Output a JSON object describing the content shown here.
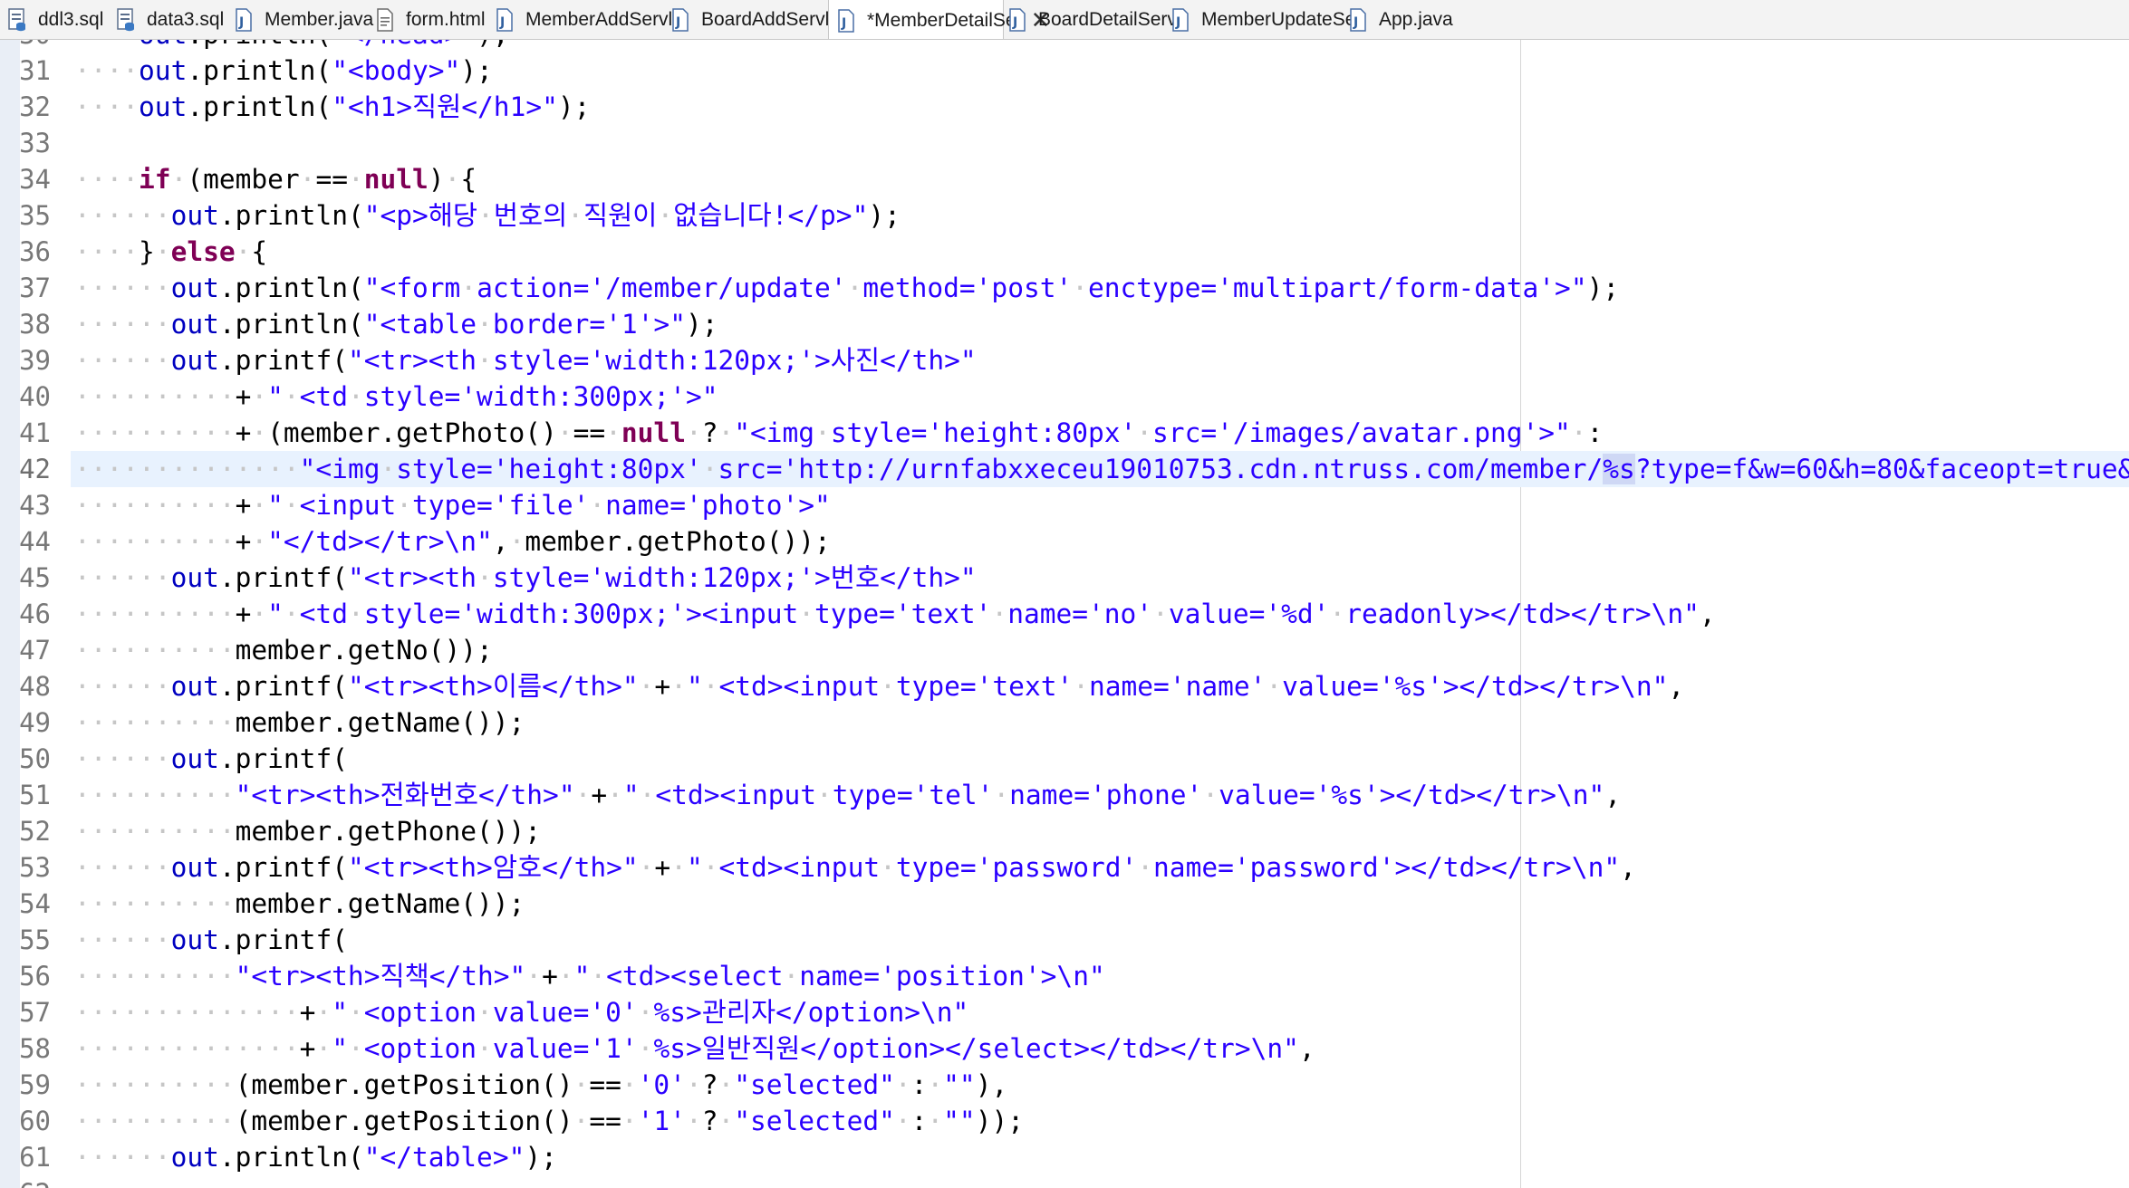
{
  "tabs": [
    {
      "label": "ddl3.sql",
      "icon": "sql-file-icon",
      "active": false
    },
    {
      "label": "data3.sql",
      "icon": "sql-file-icon",
      "active": false
    },
    {
      "label": "Member.java",
      "icon": "java-file-icon",
      "active": false
    },
    {
      "label": "form.html",
      "icon": "html-file-icon",
      "active": false
    },
    {
      "label": "MemberAddServle",
      "icon": "java-file-icon",
      "active": false
    },
    {
      "label": "BoardAddServlet",
      "icon": "java-file-icon",
      "active": false
    },
    {
      "label": "*MemberDetailSe",
      "icon": "java-file-icon",
      "active": true
    },
    {
      "label": "BoardDetailServ",
      "icon": "java-file-icon",
      "active": false
    },
    {
      "label": "MemberUpdateSer",
      "icon": "java-file-icon",
      "active": false
    },
    {
      "label": "App.java",
      "icon": "java-file-icon",
      "active": false
    }
  ],
  "editor": {
    "current_line": 42,
    "lines": [
      {
        "n": 30,
        "t": "····out.println(\"</head>\");"
      },
      {
        "n": 31,
        "t": "····out.println(\"<body>\");"
      },
      {
        "n": 32,
        "t": "····out.println(\"<h1>직원</h1>\");"
      },
      {
        "n": 33,
        "t": ""
      },
      {
        "n": 34,
        "t": "····if·(member·==·null)·{"
      },
      {
        "n": 35,
        "t": "······out.println(\"<p>해당·번호의·직원이·없습니다!</p>\");"
      },
      {
        "n": 36,
        "t": "····}·else·{"
      },
      {
        "n": 37,
        "t": "······out.println(\"<form·action='/member/update'·method='post'·enctype='multipart/form-data'>\");"
      },
      {
        "n": 38,
        "t": "······out.println(\"<table·border='1'>\");"
      },
      {
        "n": 39,
        "t": "······out.printf(\"<tr><th·style='width:120px;'>사진</th>\""
      },
      {
        "n": 40,
        "t": "··········+·\"·<td·style='width:300px;'>\""
      },
      {
        "n": 41,
        "t": "··········+·(member.getPhoto()·==·null·?·\"<img·style='height:80px'·src='/images/avatar.png'>\"·:"
      },
      {
        "n": 42,
        "t": "··············\"<img·style='height:80px'·src='http://urnfabxxeceu19010753.cdn.ntruss.com/member/%s?type=f&w=60&h=80&faceopt=true&ttype=jpg'>\")"
      },
      {
        "n": 43,
        "t": "··········+·\"·<input·type='file'·name='photo'>\""
      },
      {
        "n": 44,
        "t": "··········+·\"</td></tr>\\n\",·member.getPhoto());"
      },
      {
        "n": 45,
        "t": "······out.printf(\"<tr><th·style='width:120px;'>번호</th>\""
      },
      {
        "n": 46,
        "t": "··········+·\"·<td·style='width:300px;'><input·type='text'·name='no'·value='%d'·readonly></td></tr>\\n\","
      },
      {
        "n": 47,
        "t": "··········member.getNo());"
      },
      {
        "n": 48,
        "t": "······out.printf(\"<tr><th>이름</th>\"·+·\"·<td><input·type='text'·name='name'·value='%s'></td></tr>\\n\","
      },
      {
        "n": 49,
        "t": "··········member.getName());"
      },
      {
        "n": 50,
        "t": "······out.printf("
      },
      {
        "n": 51,
        "t": "··········\"<tr><th>전화번호</th>\"·+·\"·<td><input·type='tel'·name='phone'·value='%s'></td></tr>\\n\","
      },
      {
        "n": 52,
        "t": "··········member.getPhone());"
      },
      {
        "n": 53,
        "t": "······out.printf(\"<tr><th>암호</th>\"·+·\"·<td><input·type='password'·name='password'></td></tr>\\n\","
      },
      {
        "n": 54,
        "t": "··········member.getName());"
      },
      {
        "n": 55,
        "t": "······out.printf("
      },
      {
        "n": 56,
        "t": "··········\"<tr><th>직책</th>\"·+·\"·<td><select·name='position'>\\n\""
      },
      {
        "n": 57,
        "t": "··············+·\"·<option·value='0'·%s>관리자</option>\\n\""
      },
      {
        "n": 58,
        "t": "··············+·\"·<option·value='1'·%s>일반직원</option></select></td></tr>\\n\","
      },
      {
        "n": 59,
        "t": "··········(member.getPosition()·==·'0'·?·\"selected\"·:·\"\"),"
      },
      {
        "n": 60,
        "t": "··········(member.getPosition()·==·'1'·?·\"selected\"·:·\"\"));"
      },
      {
        "n": 61,
        "t": "······out.println(\"</table>\");"
      },
      {
        "n": 62,
        "t": ""
      }
    ]
  },
  "colors": {
    "keyword": "#7f0055",
    "string": "#2a00ff",
    "field": "#0000c0",
    "whitespace_marker": "#c6c6c6",
    "line_number": "#787878",
    "current_line_bg": "#e8f2fe"
  }
}
